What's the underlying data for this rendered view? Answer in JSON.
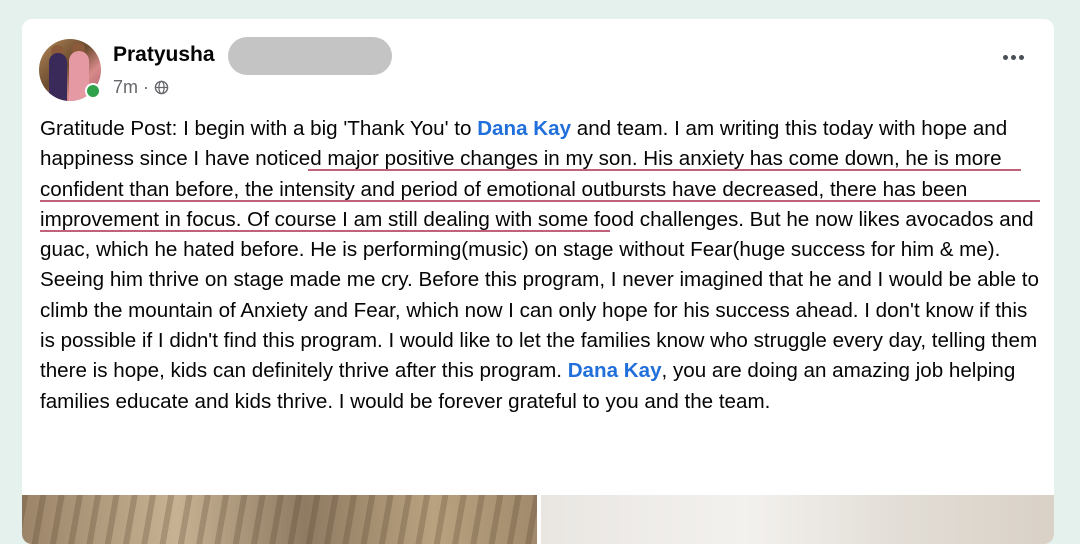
{
  "post": {
    "author": "Pratyusha",
    "time": "7m",
    "separator": "·",
    "audience_icon": "globe-icon",
    "menu_icon": "more-options-icon",
    "text": {
      "s1": "Gratitude Post: I begin with a big 'Thank You' to ",
      "mention": "Dana Kay",
      "s2": " and team. I am writing this today with hope and happiness since ",
      "highlight": "I have noticed major positive changes in my son. His anxiety has come down, he is more confident than before, the intensity and period of emotional outbursts have decreased, there has been improvement in focus.",
      "s3": " Of course I am still dealing with some food challenges. But he now likes avocados and guac, which he hated before. He is performing(music) on stage without Fear(huge success for him & me). Seeing him thrive on stage made me cry. Before this program, I never imagined that he and I would be able to climb the mountain of Anxiety and Fear, which now I can only hope for his success ahead. I don't know if this is possible if I didn't find this program. I would like to let the families know who struggle every day, telling them there is hope, kids can definitely thrive after this program. ",
      "s4": ", you are doing an amazing job helping families educate and kids thrive. I would be forever grateful to you and the team."
    }
  },
  "colors": {
    "mention": "#216fdb",
    "underline": "#c0627a",
    "online": "#31a24c",
    "background": "#e4f1ec"
  }
}
